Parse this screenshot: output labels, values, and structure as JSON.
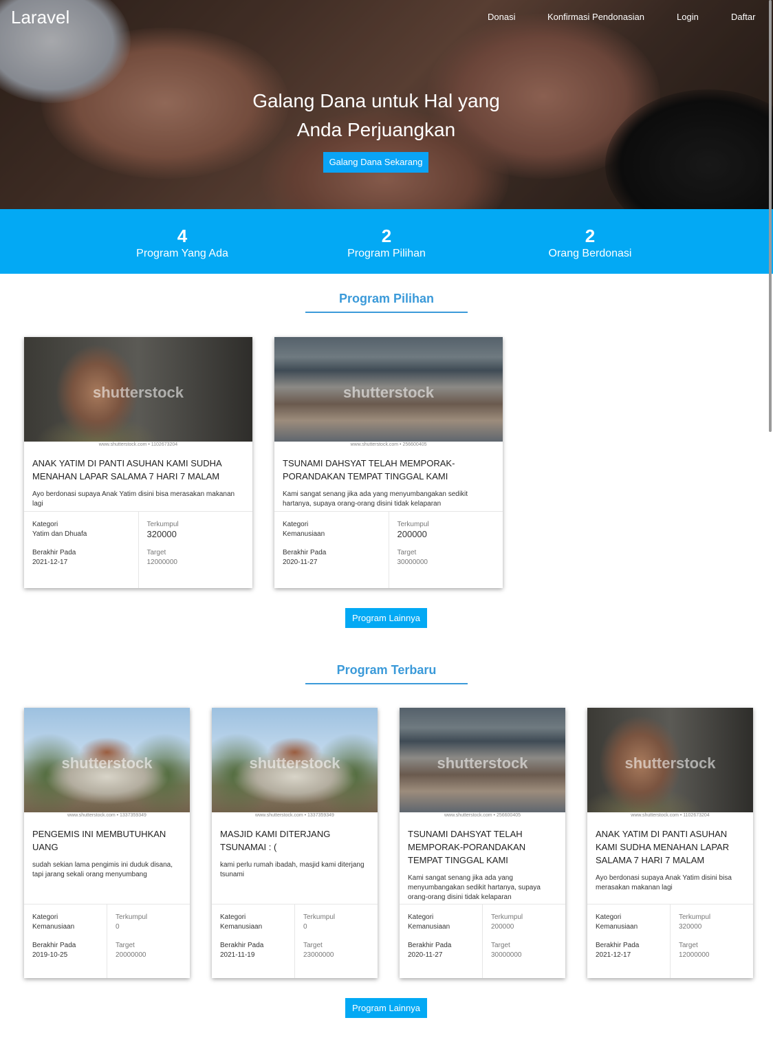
{
  "nav": {
    "brand": "Laravel",
    "links": [
      "Donasi",
      "Konfirmasi Pendonasian",
      "Login",
      "Daftar"
    ]
  },
  "hero": {
    "title_line1": "Galang Dana untuk Hal yang",
    "title_line2": "Anda Perjuangkan",
    "button": "Galang Dana Sekarang"
  },
  "stats": [
    {
      "value": "4",
      "label": "Program Yang Ada"
    },
    {
      "value": "2",
      "label": "Program Pilihan"
    },
    {
      "value": "2",
      "label": "Orang Berdonasi"
    }
  ],
  "labels": {
    "kategori": "Kategori",
    "berakhir": "Berakhir Pada",
    "terkumpul": "Terkumpul",
    "target": "Target",
    "more": "Program Lainnya",
    "watermark": "shutterstock"
  },
  "pilihan": {
    "heading": "Program Pilihan",
    "cards": [
      {
        "image": "boy",
        "caption": "www.shutterstock.com • 1102673204",
        "title": "ANAK YATIM DI PANTI ASUHAN KAMI SUDHA MENAHAN LAPAR SALAMA 7 HARI 7 MALAM",
        "desc": "Ayo berdonasi supaya Anak Yatim disini bisa merasakan makanan lagi",
        "kategori": "Yatim dan Dhuafa",
        "berakhir": "2021-12-17",
        "terkumpul": "320000",
        "target": "12000000"
      },
      {
        "image": "tsunami",
        "caption": "www.shutterstock.com • 256600405",
        "title": "TSUNAMI DAHSYAT TELAH MEMPORAK-PORANDAKAN TEMPAT TINGGAL KAMI",
        "desc": "Kami sangat senang jika ada yang menyumbangakan sedikit hartanya, supaya orang-orang disini tidak kelaparan",
        "kategori": "Kemanusiaan",
        "berakhir": "2020-11-27",
        "terkumpul": "200000",
        "target": "30000000"
      }
    ]
  },
  "terbaru": {
    "heading": "Program Terbaru",
    "cards": [
      {
        "image": "mosque",
        "caption": "www.shutterstock.com • 1337359349",
        "title": "PENGEMIS INI MEMBUTUHKAN UANG",
        "desc": "sudah sekian lama pengimis ini duduk disana, tapi jarang sekali orang menyumbang",
        "kategori": "Kemanusiaan",
        "berakhir": "2019-10-25",
        "terkumpul": "0",
        "target": "20000000"
      },
      {
        "image": "mosque",
        "caption": "www.shutterstock.com • 1337359349",
        "title": "MASJID KAMI DITERJANG TSUNAMAI : (",
        "desc": "kami perlu rumah ibadah, masjid kami diterjang tsunami",
        "kategori": "Kemanusiaan",
        "berakhir": "2021-11-19",
        "terkumpul": "0",
        "target": "23000000"
      },
      {
        "image": "tsunami",
        "caption": "www.shutterstock.com • 256600405",
        "title": "TSUNAMI DAHSYAT TELAH MEMPORAK-PORANDAKAN TEMPAT TINGGAL KAMI",
        "desc": "Kami sangat senang jika ada yang menyumbangakan sedikit hartanya, supaya orang-orang disini tidak kelaparan",
        "kategori": "Kemanusiaan",
        "berakhir": "2020-11-27",
        "terkumpul": "200000",
        "target": "30000000"
      },
      {
        "image": "boy",
        "caption": "www.shutterstock.com • 1102673204",
        "title": "ANAK YATIM DI PANTI ASUHAN KAMI SUDHA MENAHAN LAPAR SALAMA 7 HARI 7 MALAM",
        "desc": "Ayo berdonasi supaya Anak Yatim disini bisa merasakan makanan lagi",
        "kategori": "Kemanusiaan",
        "berakhir": "2021-12-17",
        "terkumpul": "320000",
        "target": "12000000"
      }
    ]
  },
  "colors": {
    "accent": "#03a9f4",
    "heading": "#3b9ad9"
  }
}
